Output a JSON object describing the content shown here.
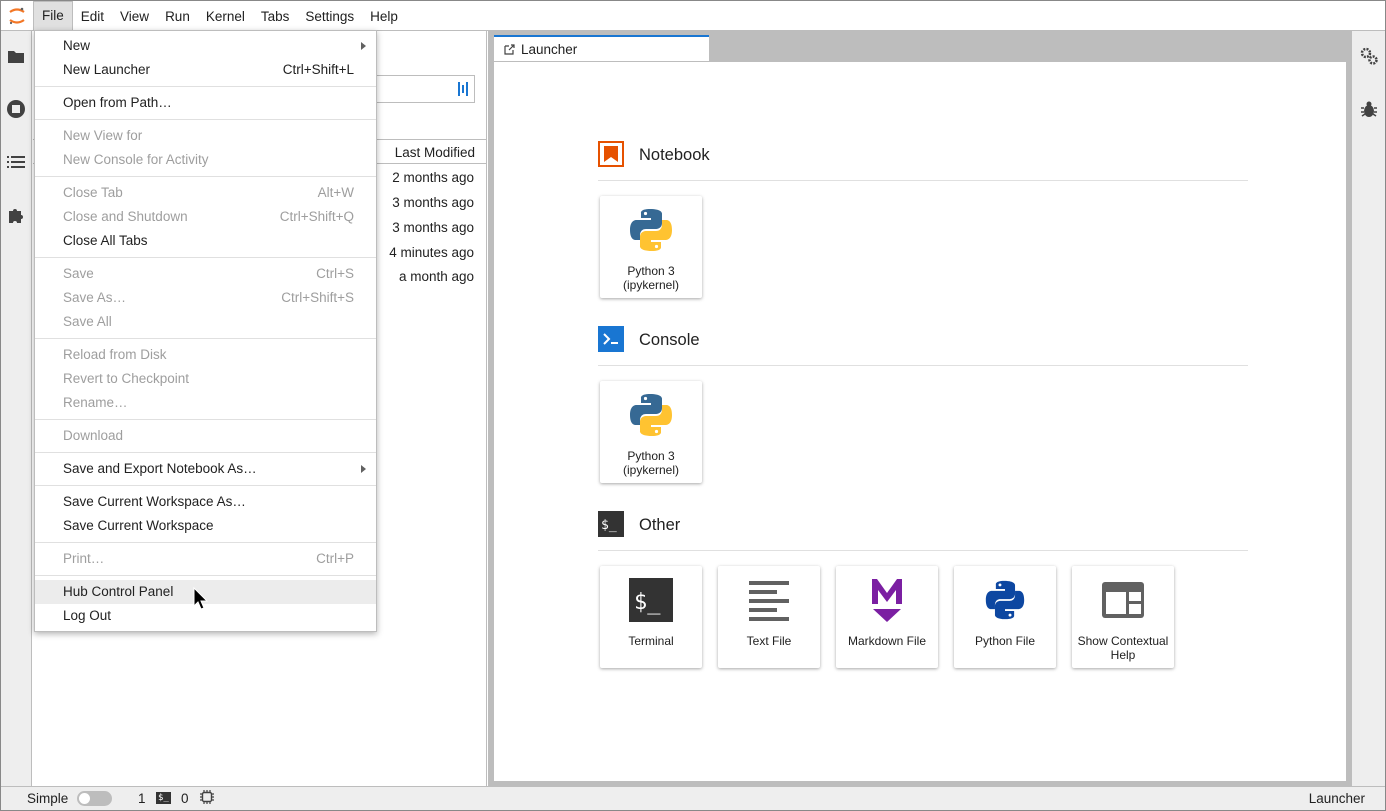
{
  "menubar": {
    "items": [
      "File",
      "Edit",
      "View",
      "Run",
      "Kernel",
      "Tabs",
      "Settings",
      "Help"
    ]
  },
  "sidebar": {
    "left_icons": [
      "folder-icon",
      "stop-circle-icon",
      "list-icon",
      "puzzle-icon"
    ],
    "right_icons": [
      "gears-icon",
      "bug-icon"
    ]
  },
  "filebrowser": {
    "column_last_modified": "Last Modified",
    "rows": [
      "2 months ago",
      "3 months ago",
      "3 months ago",
      "4 minutes ago",
      "a month ago"
    ]
  },
  "file_menu": {
    "items": [
      {
        "label": "New",
        "shortcut": "",
        "disabled": false,
        "submenu": true
      },
      {
        "label": "New Launcher",
        "shortcut": "Ctrl+Shift+L",
        "disabled": false
      },
      {
        "label": "Open from Path…",
        "shortcut": "",
        "disabled": false
      },
      {
        "label": "New View for",
        "shortcut": "",
        "disabled": true
      },
      {
        "label": "New Console for Activity",
        "shortcut": "",
        "disabled": true
      },
      {
        "label": "Close Tab",
        "shortcut": "Alt+W",
        "disabled": true
      },
      {
        "label": "Close and Shutdown",
        "shortcut": "Ctrl+Shift+Q",
        "disabled": true
      },
      {
        "label": "Close All Tabs",
        "shortcut": "",
        "disabled": false
      },
      {
        "label": "Save",
        "shortcut": "Ctrl+S",
        "disabled": true
      },
      {
        "label": "Save As…",
        "shortcut": "Ctrl+Shift+S",
        "disabled": true
      },
      {
        "label": "Save All",
        "shortcut": "",
        "disabled": true
      },
      {
        "label": "Reload from Disk",
        "shortcut": "",
        "disabled": true
      },
      {
        "label": "Revert to Checkpoint",
        "shortcut": "",
        "disabled": true
      },
      {
        "label": "Rename…",
        "shortcut": "",
        "disabled": true
      },
      {
        "label": "Download",
        "shortcut": "",
        "disabled": true
      },
      {
        "label": "Save and Export Notebook As…",
        "shortcut": "",
        "disabled": false,
        "submenu": true
      },
      {
        "label": "Save Current Workspace As…",
        "shortcut": "",
        "disabled": false
      },
      {
        "label": "Save Current Workspace",
        "shortcut": "",
        "disabled": false
      },
      {
        "label": "Print…",
        "shortcut": "Ctrl+P",
        "disabled": true
      },
      {
        "label": "Hub Control Panel",
        "shortcut": "",
        "disabled": false,
        "hover": true
      },
      {
        "label": "Log Out",
        "shortcut": "",
        "disabled": false
      }
    ]
  },
  "launcher": {
    "tab_label": "Launcher",
    "sections": {
      "notebook": {
        "title": "Notebook",
        "cards": [
          {
            "label": "Python 3\n(ipykernel)"
          }
        ]
      },
      "console": {
        "title": "Console",
        "cards": [
          {
            "label": "Python 3\n(ipykernel)"
          }
        ]
      },
      "other": {
        "title": "Other",
        "cards": [
          {
            "label": "Terminal"
          },
          {
            "label": "Text File"
          },
          {
            "label": "Markdown File"
          },
          {
            "label": "Python File"
          },
          {
            "label": "Show Contextual Help"
          }
        ]
      }
    }
  },
  "statusbar": {
    "mode_label": "Simple",
    "kernels_count": "1",
    "terminal_badge": "$_",
    "terminals_count": "0",
    "right_label": "Launcher"
  },
  "colors": {
    "accent": "#1976d2",
    "notebook_icon": "#e65100",
    "console_icon": "#1976d2",
    "markdown_icon": "#7b1fa2",
    "python_blue": "#366994",
    "python_yellow": "#ffc331"
  }
}
